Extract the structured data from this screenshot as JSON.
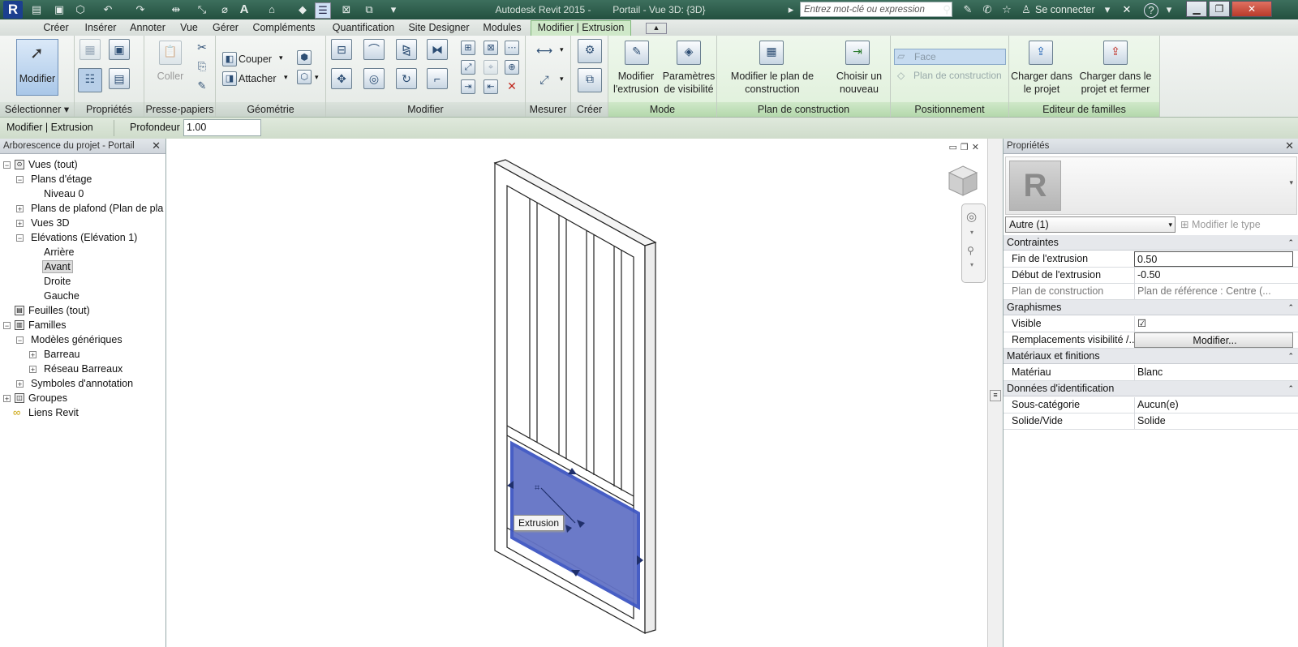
{
  "titlebar": {
    "app_title": "Autodesk Revit 2015 -",
    "doc_title": "Portail - Vue 3D: {3D}",
    "search_placeholder": "Entrez mot-clé ou expression",
    "signin": "Se connecter",
    "help": "?"
  },
  "tabs": [
    "Créer",
    "Insérer",
    "Annoter",
    "Vue",
    "Gérer",
    "Compléments",
    "Quantification",
    "Site Designer",
    "Modules",
    "Modifier | Extrusion"
  ],
  "ribbon": {
    "modify_label": "Modifier",
    "paste_label": "Coller",
    "cut_label": "Couper",
    "join_label": "Attacher",
    "edit_extrusion": "Modifier l'extrusion",
    "visibility_settings": "Paramètres de visibilité",
    "edit_workplane": "Modifier le plan de construction",
    "pick_new": "Choisir un nouveau",
    "face_label": "Face",
    "workplane_label": "Plan de construction",
    "load_project": "Charger dans le projet",
    "load_close": "Charger dans le projet et fermer",
    "panels": {
      "select": "Sélectionner ▾",
      "properties": "Propriétés",
      "clipboard": "Presse-papiers",
      "geometry": "Géométrie",
      "modify": "Modifier",
      "measure": "Mesurer",
      "create": "Créer",
      "mode": "Mode",
      "workplane": "Plan de construction",
      "placement": "Positionnement",
      "family_editor": "Editeur de familles"
    }
  },
  "optionsbar": {
    "context": "Modifier | Extrusion",
    "depth_label": "Profondeur",
    "depth_value": "1.00"
  },
  "browser": {
    "title": "Arborescence du projet - Portail",
    "items": [
      {
        "label": "Vues (tout)"
      },
      {
        "label": "Plans d'étage"
      },
      {
        "label": "Niveau 0"
      },
      {
        "label": "Plans de plafond (Plan de pla"
      },
      {
        "label": "Vues 3D"
      },
      {
        "label": "Elévations (Elévation 1)"
      },
      {
        "label": "Arrière"
      },
      {
        "label": "Avant"
      },
      {
        "label": "Droite"
      },
      {
        "label": "Gauche"
      },
      {
        "label": "Feuilles (tout)"
      },
      {
        "label": "Familles"
      },
      {
        "label": "Modèles génériques"
      },
      {
        "label": "Barreau"
      },
      {
        "label": "Réseau Barreaux"
      },
      {
        "label": "Symboles d'annotation"
      },
      {
        "label": "Groupes"
      },
      {
        "label": "Liens Revit"
      }
    ]
  },
  "viewport": {
    "tooltip": "Extrusion"
  },
  "properties": {
    "title": "Propriétés",
    "type_selector": "Autre (1)",
    "edit_type": "Modifier le type",
    "groups": {
      "constraints": "Contraintes",
      "graphics": "Graphismes",
      "materials": "Matériaux et finitions",
      "identity": "Données d'identification"
    },
    "rows": {
      "extrusion_end": {
        "key": "Fin de l'extrusion",
        "value": "0.50"
      },
      "extrusion_start": {
        "key": "Début de l'extrusion",
        "value": "-0.50"
      },
      "work_plane": {
        "key": "Plan de construction",
        "value": "Plan de référence : Centre (..."
      },
      "visible": {
        "key": "Visible",
        "value": "☑"
      },
      "visibility_overrides": {
        "key": "Remplacements visibilité /...",
        "value": "Modifier..."
      },
      "material": {
        "key": "Matériau",
        "value": "Blanc"
      },
      "subcategory": {
        "key": "Sous-catégorie",
        "value": "Aucun(e)"
      },
      "solid_void": {
        "key": "Solide/Vide",
        "value": "Solide"
      }
    }
  }
}
